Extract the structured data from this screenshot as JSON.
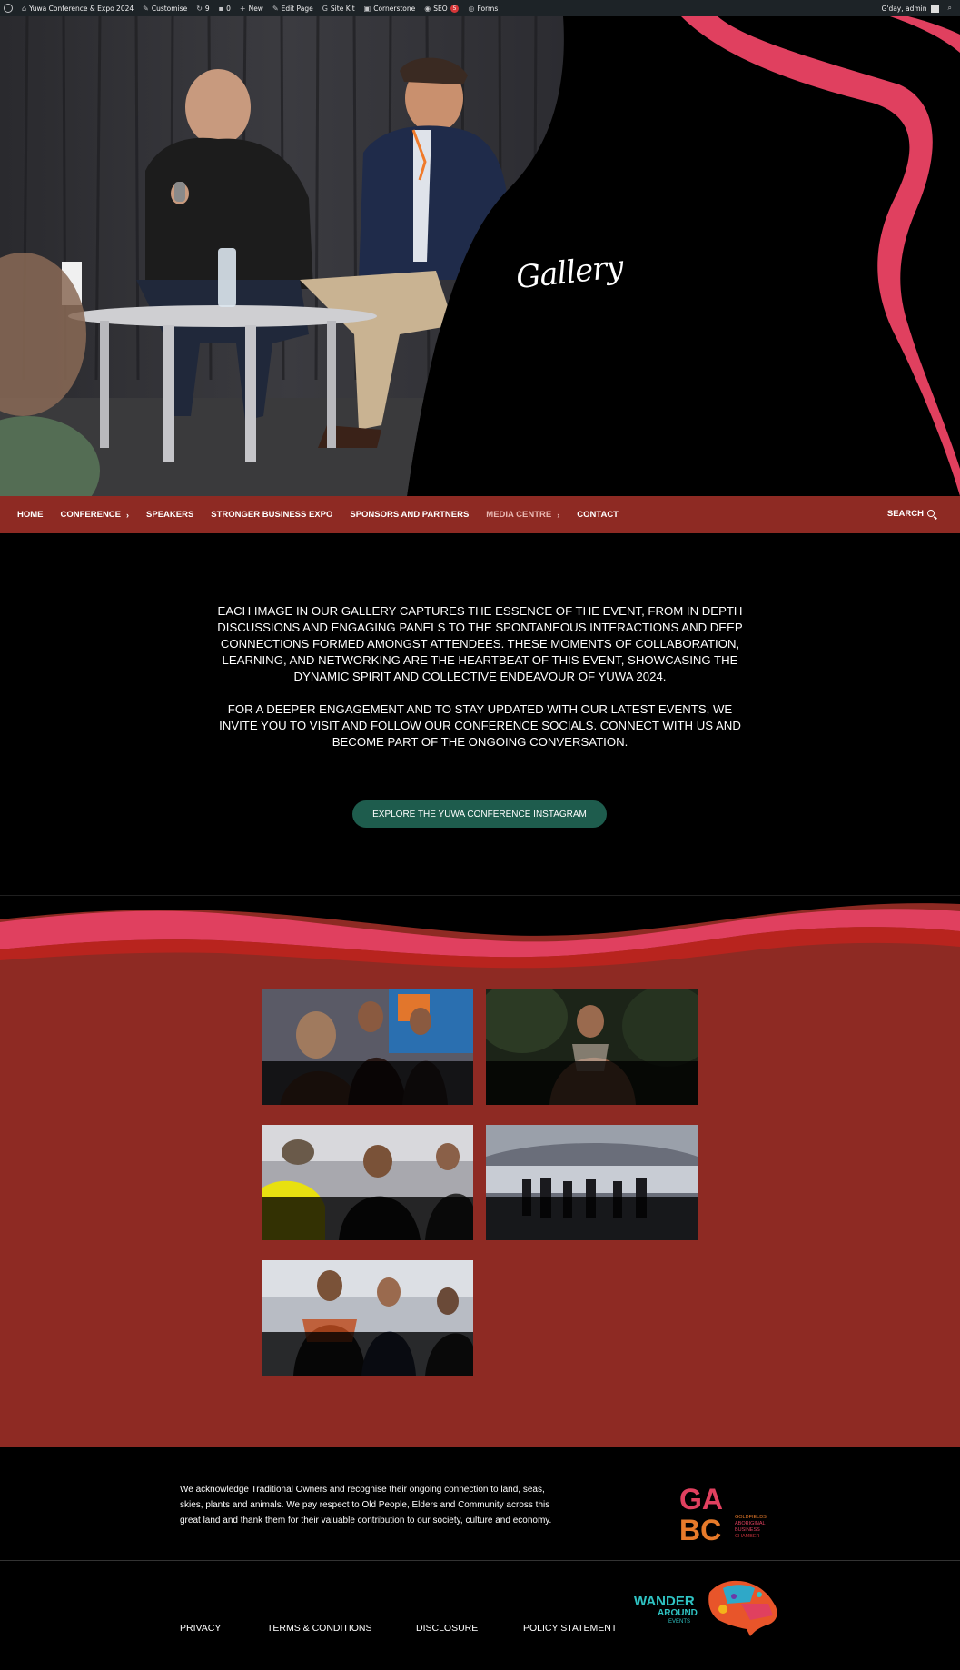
{
  "admin_bar": {
    "site_name": "Yuwa Conference & Expo 2024",
    "customise": "Customise",
    "updates": "9",
    "comments": "0",
    "new": "New",
    "edit_page": "Edit Page",
    "site_kit": "Site Kit",
    "cornerstone": "Cornerstone",
    "seo": "SEO",
    "seo_count": "5",
    "forms": "Forms",
    "greeting": "G'day, admin"
  },
  "hero": {
    "title": "Gallery"
  },
  "nav": {
    "items": [
      {
        "label": "HOME"
      },
      {
        "label": "CONFERENCE"
      },
      {
        "label": "SPEAKERS"
      },
      {
        "label": "STRONGER BUSINESS EXPO"
      },
      {
        "label": "SPONSORS AND PARTNERS"
      },
      {
        "label": "MEDIA CENTRE"
      },
      {
        "label": "CONTACT"
      }
    ],
    "search_label": "SEARCH"
  },
  "intro": {
    "paragraph_1": "EACH IMAGE IN OUR GALLERY CAPTURES THE ESSENCE OF THE EVENT, FROM IN DEPTH DISCUSSIONS AND ENGAGING PANELS TO THE SPONTANEOUS INTERACTIONS AND DEEP CONNECTIONS FORMED AMONGST ATTENDEES. THESE MOMENTS OF COLLABORATION, LEARNING, AND NETWORKING ARE THE HEARTBEAT OF THIS EVENT, SHOWCASING THE DYNAMIC SPIRIT AND COLLECTIVE ENDEAVOUR OF YUWA 2024.",
    "paragraph_2": "FOR A DEEPER ENGAGEMENT AND TO STAY UPDATED WITH OUR LATEST EVENTS, WE INVITE YOU TO VISIT AND FOLLOW OUR CONFERENCE SOCIALS. CONNECT WITH US AND BECOME PART OF THE ONGOING CONVERSATION.",
    "cta_label": "EXPLORE THE YUWA CONFERENCE INSTAGRAM"
  },
  "gallery": {
    "thumbnails": [
      "panel-discussion-photo",
      "smoking-ceremony-photo",
      "networking-photo",
      "expo-hall-photo",
      "attendees-photo"
    ]
  },
  "footer": {
    "acknowledgement": "We acknowledge Traditional Owners and recognise their ongoing connection to land, seas, skies, plants and animals. We pay respect to Old People, Elders and Community across this great land and thank them for their valuable contribution to our society, culture and economy.",
    "links": [
      {
        "label": "PRIVACY"
      },
      {
        "label": "TERMS & CONDITIONS"
      },
      {
        "label": "DISCLOSURE"
      },
      {
        "label": "POLICY STATEMENT"
      }
    ],
    "gabc_logo": {
      "letters": "GABC",
      "text_1": "GOLDFIELDS",
      "text_2": "ABORIGINAL",
      "text_3": "BUSINESS",
      "text_4": "CHAMBER"
    },
    "wander_logo": {
      "text_1": "WANDER",
      "text_2": "AROUND",
      "text_3": "EVENTS"
    }
  },
  "colors": {
    "brand_red": "#8e2a23",
    "accent_pink": "#e0405f",
    "cta_green": "#1e5c4d",
    "admin_bar": "#1d2327"
  }
}
